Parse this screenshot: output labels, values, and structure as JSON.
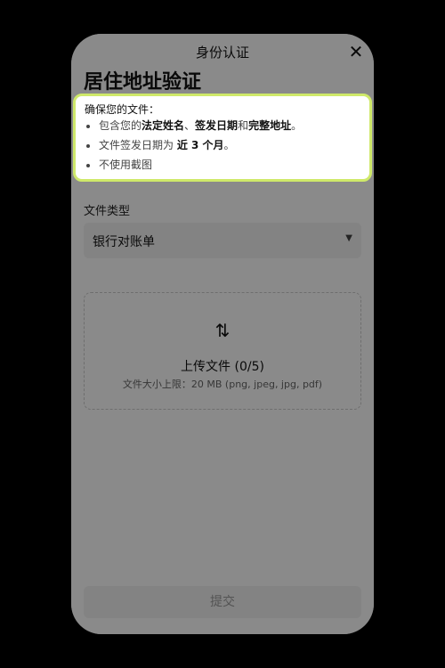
{
  "header": {
    "title": "身份认证",
    "close_label": "✕"
  },
  "page": {
    "title": "居住地址验证"
  },
  "tips": {
    "intro": "确保您的文件：",
    "items": [
      {
        "pre": "包含您的",
        "b1": "法定姓名",
        "mid": "、",
        "b2": "签发日期",
        "and": "和",
        "b3": "完整地址",
        "end": "。"
      },
      {
        "pre": "文件签发日期为 ",
        "b1": "近 3 个月",
        "end": "。"
      },
      {
        "text": "不使用截图"
      }
    ]
  },
  "form": {
    "doc_type_label": "文件类型",
    "doc_type_value": "银行对账单",
    "upload_icon": "swap-vertical-icon",
    "upload_title": "上传文件 (0/5)",
    "upload_hint": "文件大小上限：20 MB (png, jpeg, jpg, pdf)"
  },
  "footer": {
    "submit_label": "提交"
  },
  "colors": {
    "highlight_border": "#cfe96a"
  }
}
